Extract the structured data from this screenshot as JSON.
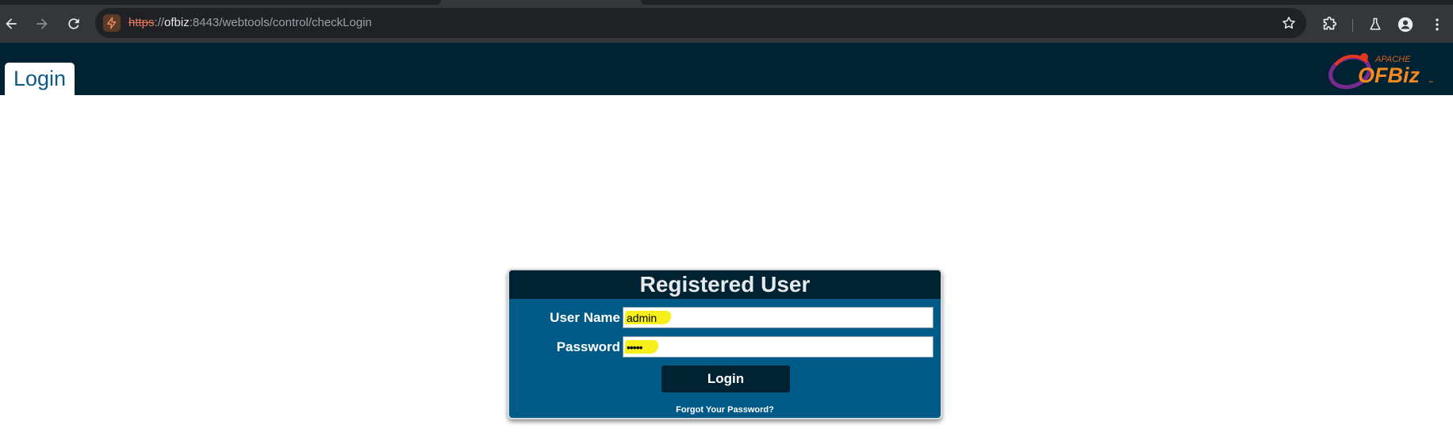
{
  "browser": {
    "url_scheme": "https",
    "url_separator": "://",
    "url_host": "ofbiz",
    "url_rest": ":8443/webtools/control/checkLogin"
  },
  "app": {
    "tab_label": "Login",
    "logo_small": "APACHE",
    "logo_main": "OFBiz"
  },
  "login_form": {
    "title": "Registered User",
    "username_label": "User Name",
    "username_value": "admin",
    "password_label": "Password",
    "password_value": "•••••",
    "submit_label": "Login",
    "forgot_link": "Forgot Your Password?"
  },
  "colors": {
    "header_bg": "#012233",
    "panel_bg": "#005a87",
    "highlight": "#f6ef1a",
    "tab_text": "#0d5a84"
  },
  "icons": [
    "back-arrow-icon",
    "forward-arrow-icon",
    "reload-icon",
    "not-secure-icon",
    "bookmark-star-icon",
    "extensions-icon",
    "labs-flask-icon",
    "profile-icon",
    "kebab-menu-icon"
  ]
}
